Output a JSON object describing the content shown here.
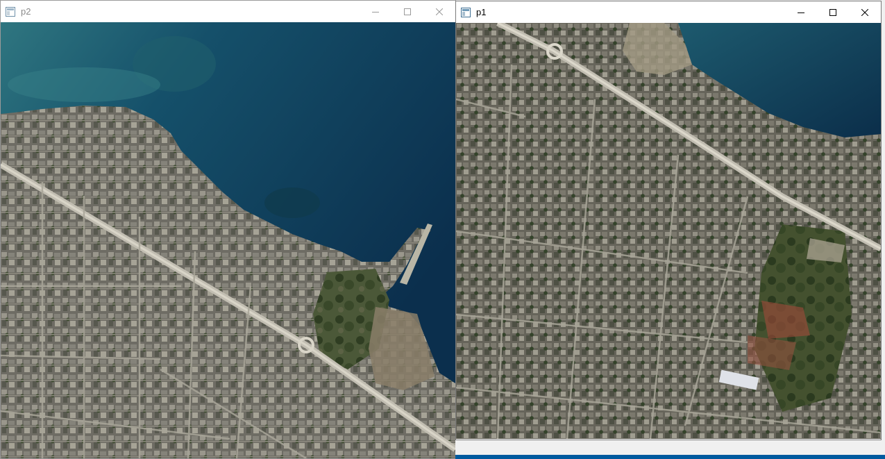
{
  "windows": [
    {
      "title": "p2",
      "active": false,
      "controls": {
        "minimize": "minimize",
        "maximize": "maximize",
        "close": "close"
      },
      "image_description_icon": "app-window-icon"
    },
    {
      "title": "p1",
      "active": true,
      "controls": {
        "minimize": "minimize",
        "maximize": "maximize",
        "close": "close"
      },
      "image_description_icon": "app-window-icon"
    }
  ],
  "colors": {
    "sea_deep": "#0d3b55",
    "sea_shallow": "#2e6f7c",
    "urban": "#7c7a70",
    "road": "#b8b4a8",
    "vegetation": "#3d4a2c",
    "taskbar": "#005a9e"
  }
}
